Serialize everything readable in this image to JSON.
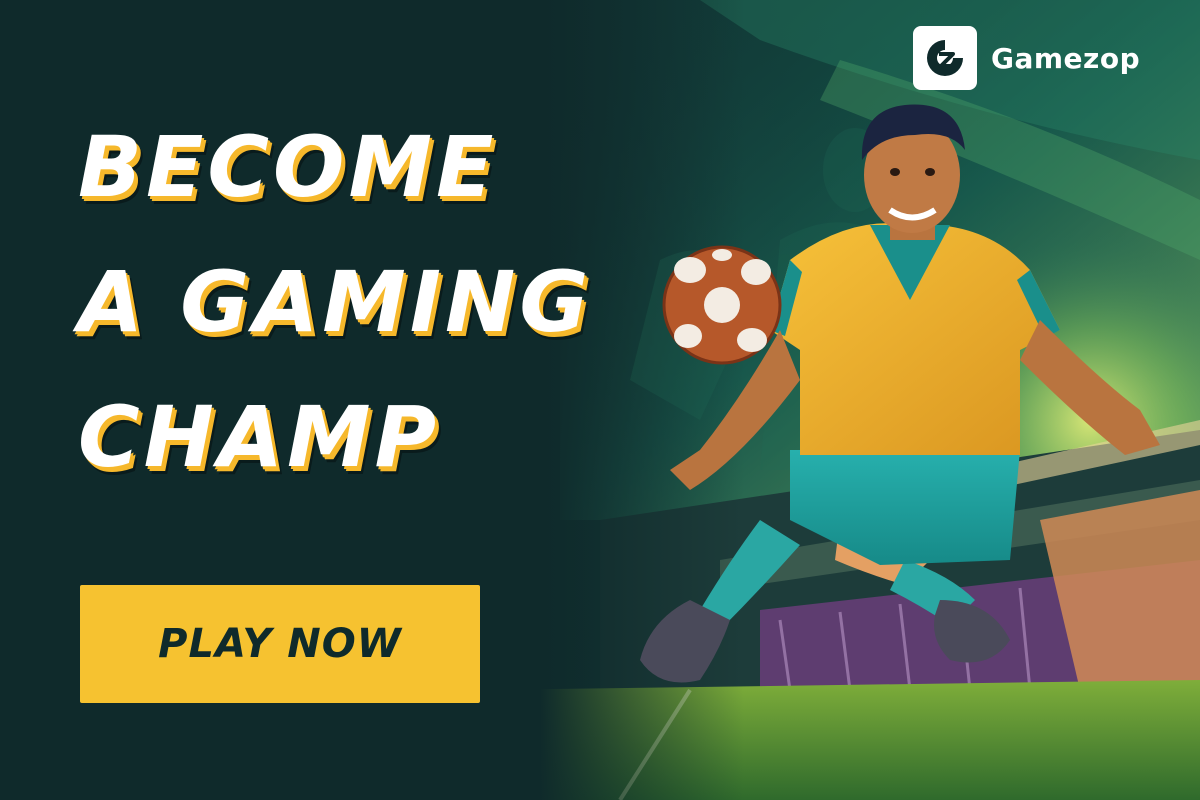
{
  "headline": {
    "line1": "BECOME",
    "line2": "A GAMING",
    "line3": "CHAMP"
  },
  "cta": {
    "label": "PLAY NOW"
  },
  "brand": {
    "name": "Gamezop",
    "logo_icon": "gamezop-logo-icon"
  },
  "colors": {
    "background": "#0f2a2b",
    "accent_yellow": "#f6c230",
    "jersey_yellow": "#f0b128",
    "teal": "#1fa3a0",
    "white": "#ffffff"
  },
  "illustration": {
    "subject": "footballer-kicking-ball",
    "ball_icon": "football-icon",
    "setting": "stadium"
  }
}
